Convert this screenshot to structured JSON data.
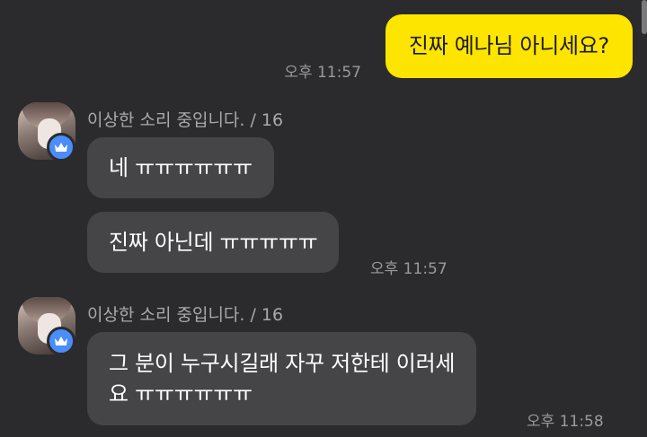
{
  "messages": {
    "outgoing_1": {
      "text": "진짜 예나님 아니세요?",
      "time": "오후 11:57"
    },
    "group_1": {
      "sender": "이상한 소리 중입니다. / 16",
      "bubble_1": "네 ㅠㅠㅠㅠㅠㅠ",
      "bubble_2": "진짜 아닌데 ㅠㅠㅠㅠㅠ",
      "time": "오후 11:57"
    },
    "group_2": {
      "sender": "이상한 소리 중입니다. / 16",
      "bubble_line_1": "그 분이 누구시길래 자꾸 저한테 이러세",
      "bubble_line_2": "요 ㅠㅠㅠㅠㅠㅠ",
      "time": "오후 11:58"
    }
  },
  "colors": {
    "background": "#2b2b2d",
    "outgoing_bubble": "#fee500",
    "incoming_bubble": "#454548",
    "badge": "#4a8dfb"
  }
}
